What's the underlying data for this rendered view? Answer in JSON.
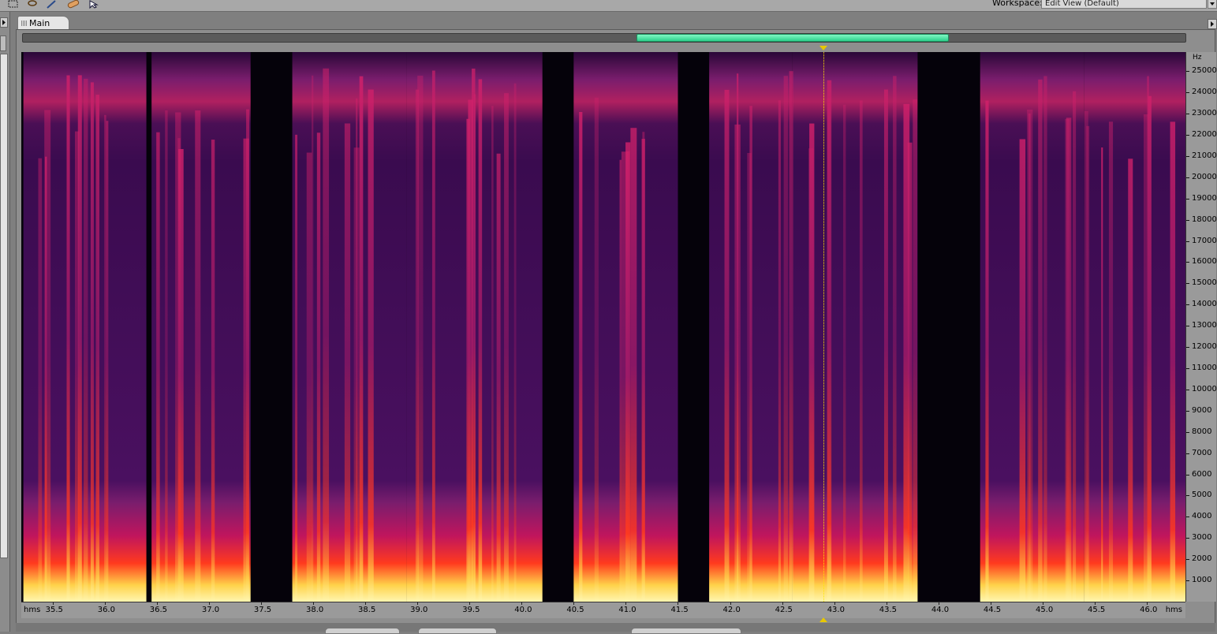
{
  "toolbar": {
    "tools": [
      "marquee-select-icon",
      "lasso-icon",
      "brush-icon",
      "spot-healing-icon",
      "move-icon"
    ],
    "workspace_label": "Workspace:",
    "workspace_value": "Edit View (Default)"
  },
  "tabs": [
    {
      "label": "Main"
    }
  ],
  "overview": {
    "zoom_start_s": 41.2,
    "zoom_end_s": 44.2
  },
  "playhead_s": 42.9,
  "frequency_axis": {
    "unit": "Hz",
    "labels": [
      "25000",
      "24000",
      "23000",
      "22000",
      "21000",
      "20000",
      "19000",
      "18000",
      "17000",
      "16000",
      "15000",
      "14000",
      "13000",
      "12000",
      "11000",
      "10000",
      "9000",
      "8000",
      "7000",
      "6000",
      "5000",
      "4000",
      "3000",
      "2000",
      "1000"
    ],
    "values": [
      25000,
      24000,
      23000,
      22000,
      21000,
      20000,
      19000,
      18000,
      17000,
      16000,
      15000,
      14000,
      13000,
      12000,
      11000,
      10000,
      9000,
      8000,
      7000,
      6000,
      5000,
      4000,
      3000,
      2000,
      1000
    ],
    "range": [
      0,
      25900
    ]
  },
  "time_axis": {
    "unit_label_left": "hms",
    "unit_label_right": "hms",
    "labels": [
      "35.5",
      "36.0",
      "36.5",
      "37.0",
      "37.5",
      "38.0",
      "38.5",
      "39.0",
      "39.5",
      "40.0",
      "40.5",
      "41.0",
      "41.5",
      "42.0",
      "42.5",
      "43.0",
      "43.5",
      "44.0",
      "44.5",
      "45.0",
      "45.5",
      "46.0"
    ],
    "values": [
      35.5,
      36.0,
      36.5,
      37.0,
      37.5,
      38.0,
      38.5,
      39.0,
      39.5,
      40.0,
      40.5,
      41.0,
      41.5,
      42.0,
      42.5,
      43.0,
      43.5,
      44.0,
      44.5,
      45.0,
      45.5,
      46.0
    ],
    "range": [
      35.2,
      46.37
    ]
  },
  "spectrogram": {
    "colormap": [
      "#05020a",
      "#3a0b4f",
      "#7a1d6d",
      "#c0155d",
      "#ff3a1e",
      "#ffd24a",
      "#fff6b0"
    ],
    "speech_segments_s": [
      [
        35.22,
        36.4
      ],
      [
        36.45,
        37.4
      ],
      [
        37.8,
        38.9
      ],
      [
        38.9,
        40.2
      ],
      [
        40.5,
        41.5
      ],
      [
        41.8,
        42.6
      ],
      [
        42.6,
        43.8
      ],
      [
        44.4,
        45.4
      ],
      [
        45.4,
        46.37
      ]
    ],
    "silence_segments_s": [
      [
        37.4,
        37.78
      ],
      [
        41.55,
        41.78
      ],
      [
        43.85,
        44.35
      ]
    ]
  }
}
